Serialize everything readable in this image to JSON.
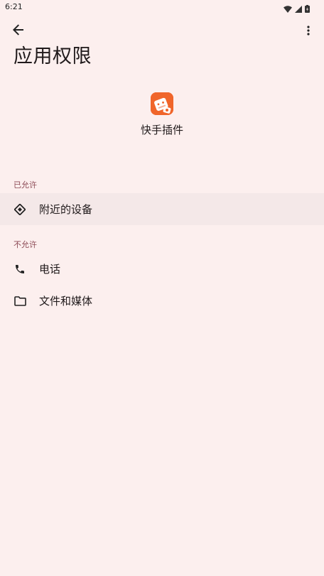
{
  "status_bar": {
    "time": "6:21",
    "icons": [
      "wifi-icon",
      "signal-icon",
      "battery-icon"
    ]
  },
  "app_bar": {
    "back_icon": "arrow-back-icon",
    "more_icon": "more-vert-icon"
  },
  "page": {
    "title": "应用权限"
  },
  "app": {
    "name": "快手插件",
    "icon": "app-icon"
  },
  "sections": {
    "allowed": {
      "label": "已允许",
      "items": [
        {
          "label": "附近的设备",
          "icon": "nearby-devices-icon"
        }
      ]
    },
    "denied": {
      "label": "不允许",
      "items": [
        {
          "label": "电话",
          "icon": "phone-icon"
        },
        {
          "label": "文件和媒体",
          "icon": "folder-icon"
        }
      ]
    }
  },
  "colors": {
    "background": "#fcefee",
    "highlight": "#f4e8e8",
    "section_label": "#8c4a55",
    "app_icon": "#f0652a"
  }
}
